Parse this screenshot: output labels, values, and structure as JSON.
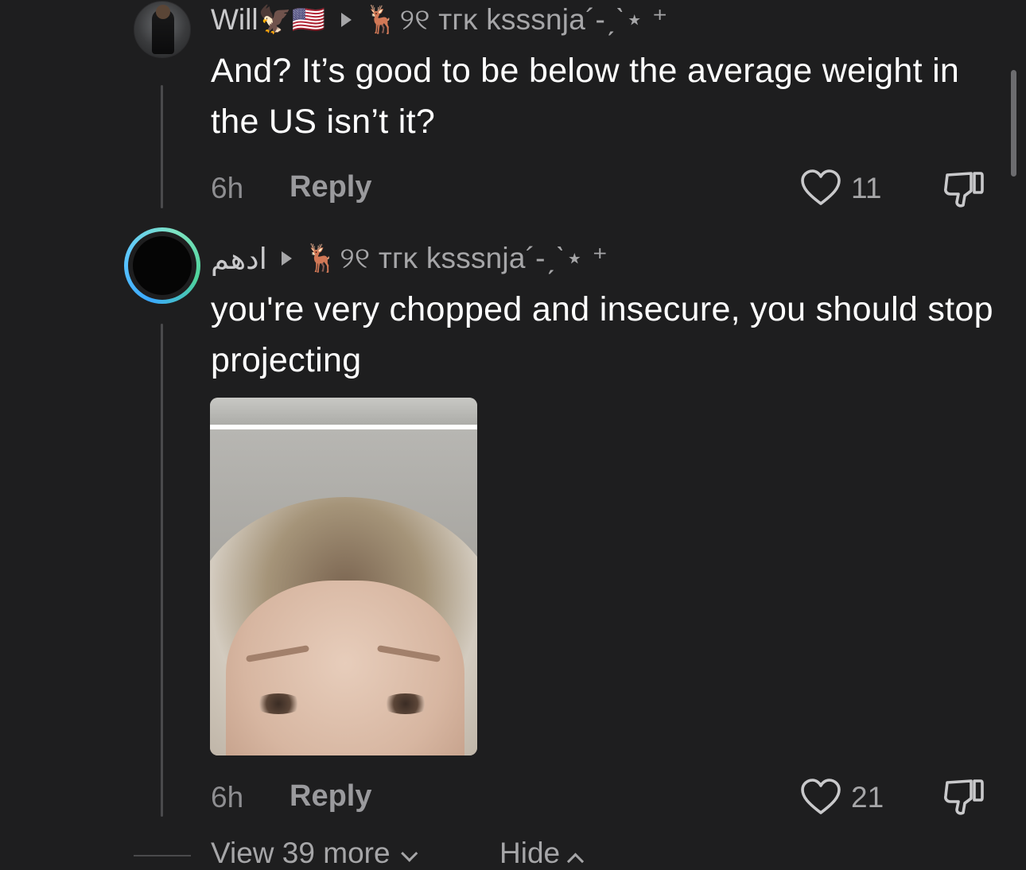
{
  "comments": [
    {
      "author": "Will",
      "author_badges": "🦅🇺🇸",
      "reply_to_emoji": "🦌",
      "reply_to_name": "୨୧ ᴛᴦᴋ ksssnja´-ˏˋ⋆ ⁺",
      "text": "And? It’s good to be below the average weight in the US isn’t it?",
      "time": "6h",
      "reply_label": "Reply",
      "likes": "11",
      "has_media": false
    },
    {
      "author": "ادهم",
      "author_badges": "",
      "reply_to_emoji": "🦌",
      "reply_to_name": "୨୧ ᴛᴦᴋ ksssnja´-ˏˋ⋆ ⁺",
      "text": "you're very chopped and insecure, you should stop projecting",
      "time": "6h",
      "reply_label": "Reply",
      "likes": "21",
      "has_media": true
    }
  ],
  "thread_footer": {
    "view_more_label": "View 39 more",
    "hide_label": "Hide"
  },
  "icons": {
    "like": "heart-outline-icon",
    "dislike": "thumbs-down-icon",
    "reply_arrow": "triangle-right-icon"
  },
  "colors": {
    "background": "#1e1e1f",
    "text_primary": "#ffffff",
    "text_secondary": "#a6a6a8",
    "ring_gradient": [
      "#3aa8ff",
      "#7ee3c3"
    ]
  }
}
